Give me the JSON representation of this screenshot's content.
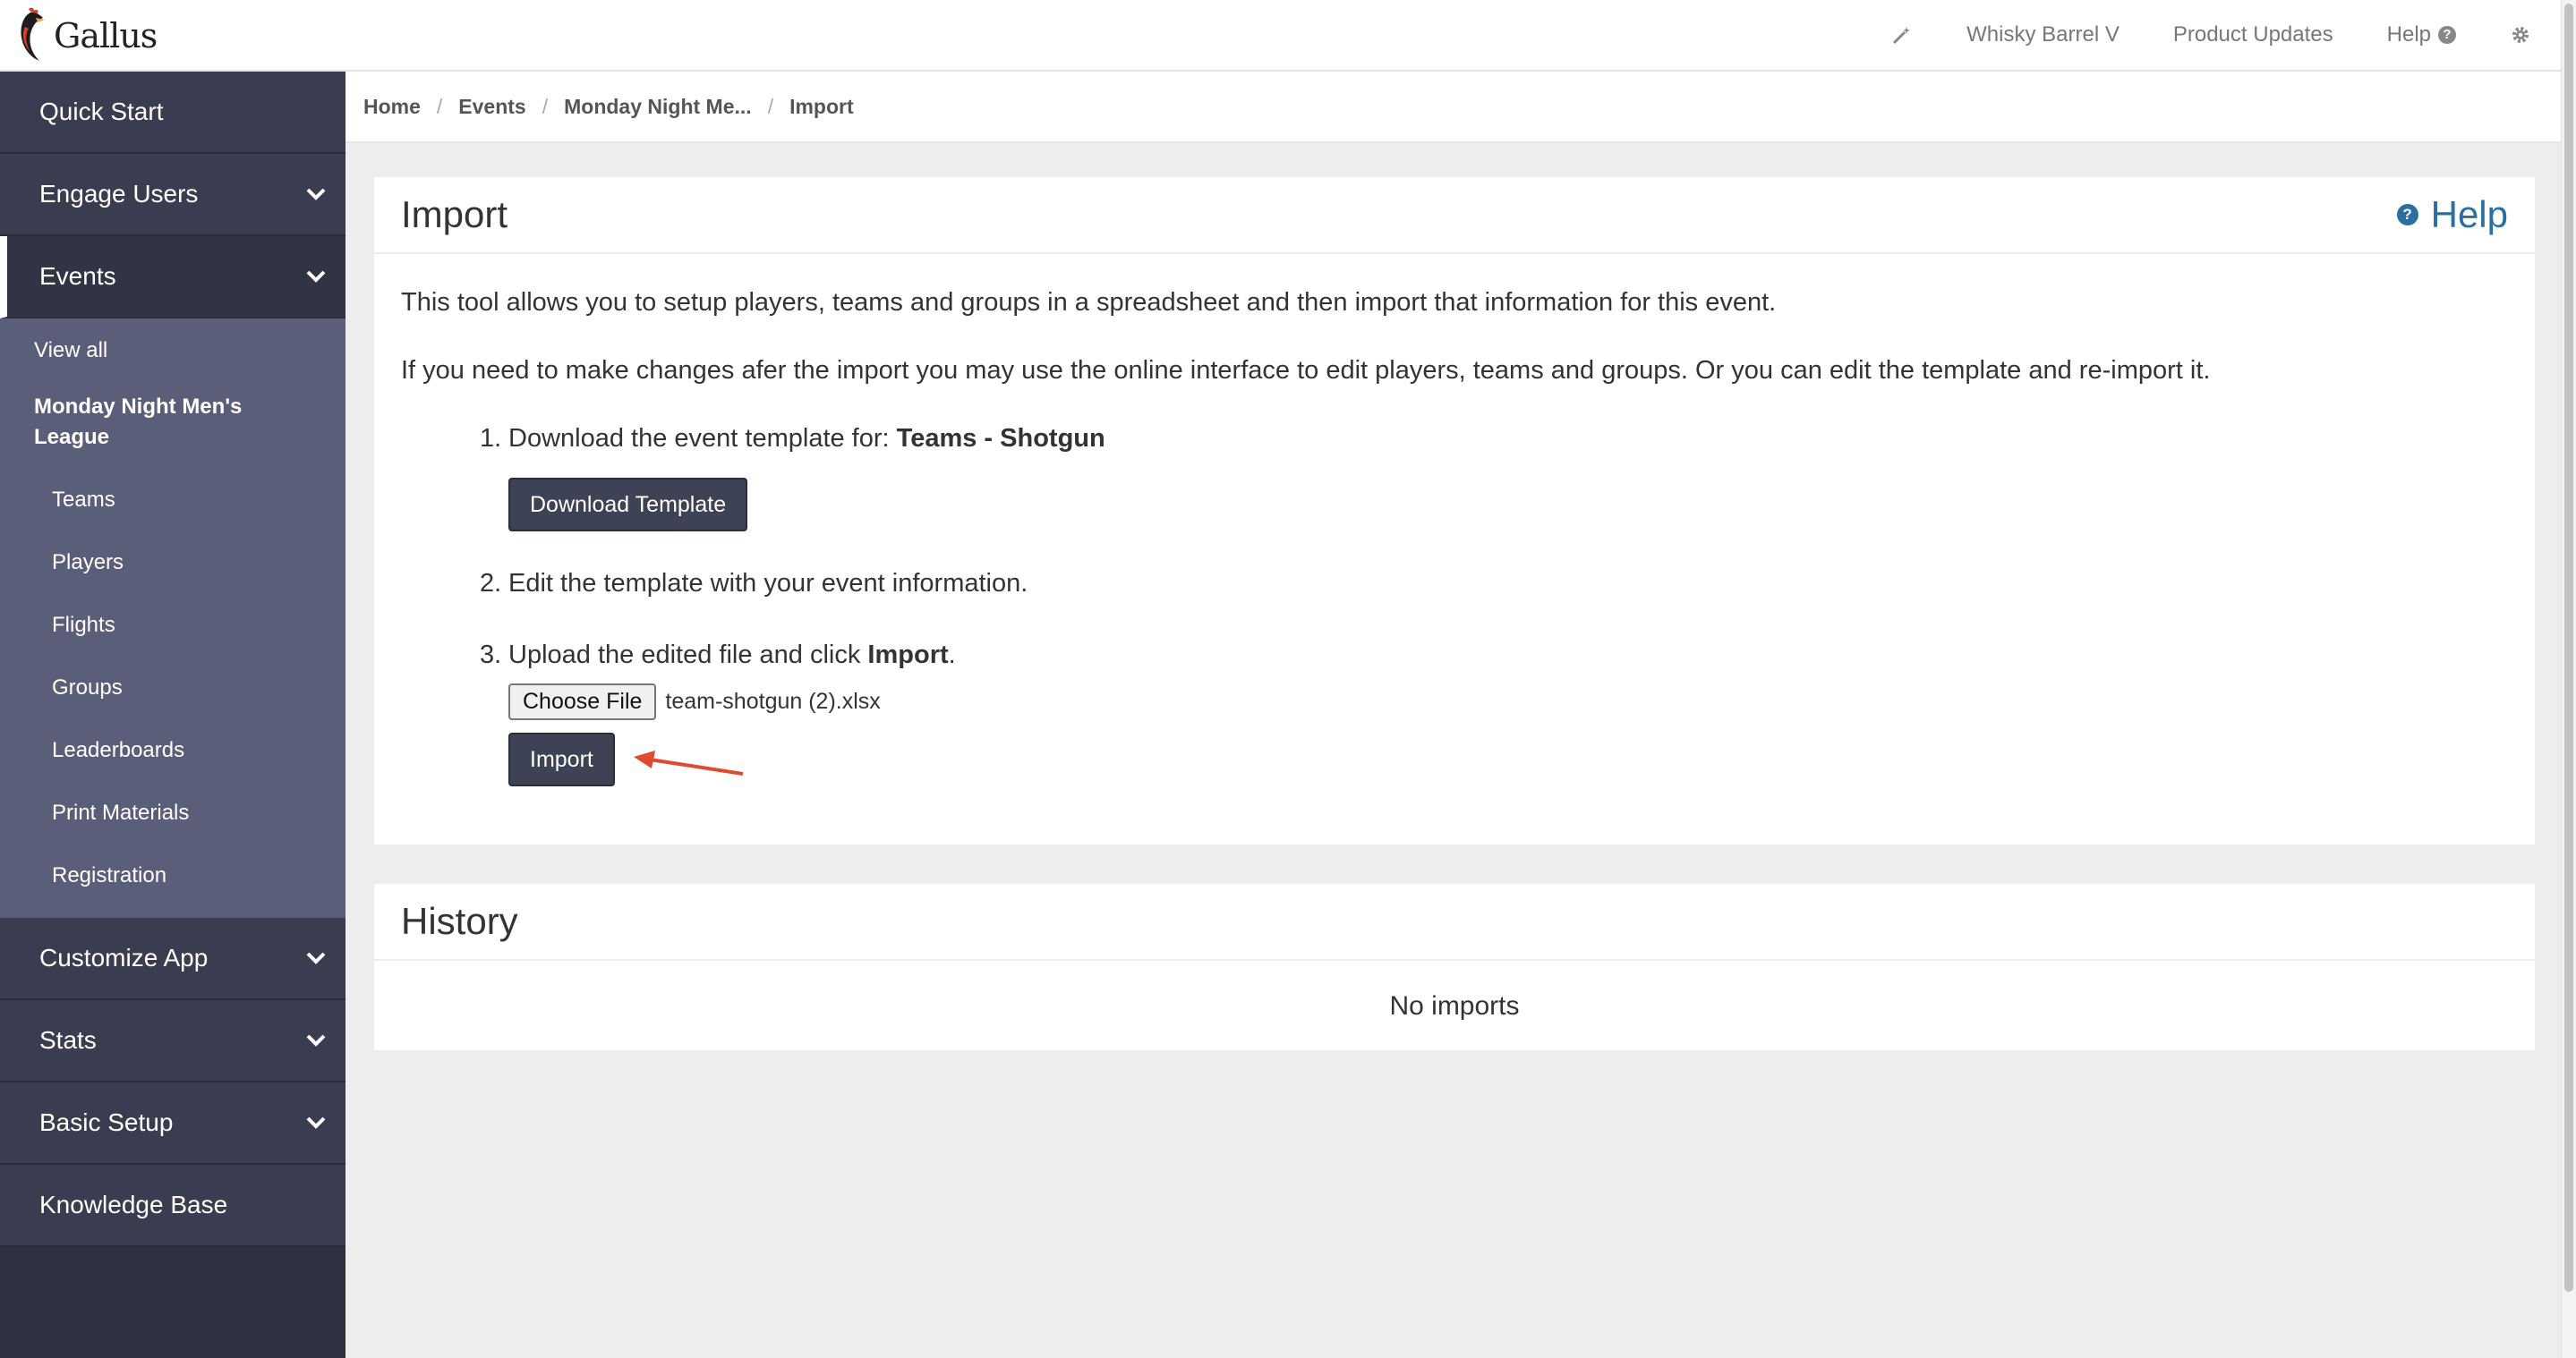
{
  "app": {
    "logo_text": "Gallus"
  },
  "topnav": {
    "wand_icon": "magic-wand-icon",
    "account": "Whisky Barrel V",
    "product_updates": "Product Updates",
    "help": "Help",
    "help_icon_glyph": "?",
    "settings_icon": "gear-icon"
  },
  "sidebar": {
    "quick_start": "Quick Start",
    "engage_users": "Engage Users",
    "events": "Events",
    "view_all": "View all",
    "event_name": "Monday Night Men's League",
    "event_items": [
      "Teams",
      "Players",
      "Flights",
      "Groups",
      "Leaderboards",
      "Print Materials",
      "Registration"
    ],
    "customize_app": "Customize App",
    "stats": "Stats",
    "basic_setup": "Basic Setup",
    "knowledge_base": "Knowledge Base"
  },
  "breadcrumb": [
    "Home",
    "Events",
    "Monday Night Me...",
    "Import"
  ],
  "import_panel": {
    "title": "Import",
    "help_label": "Help",
    "help_icon_glyph": "?",
    "intro": "This tool allows you to setup players, teams and groups in a spreadsheet and then import that information for this event.",
    "intro2": "If you need to make changes afer the import you may use the online interface to edit players, teams and groups. Or you can edit the template and re-import it.",
    "step1_num": "1.",
    "step1_text": "Download the event template for: ",
    "step1_bold": "Teams - Shotgun",
    "download_button": "Download Template",
    "step2_num": "2.",
    "step2_text": "Edit the template with your event information.",
    "step3_num": "3.",
    "step3_text": "Upload the edited file and click ",
    "step3_bold": "Import",
    "step3_end": ".",
    "choose_file": "Choose File",
    "file_name": "team-shotgun (2).xlsx",
    "import_button": "Import"
  },
  "history_panel": {
    "title": "History",
    "empty": "No imports"
  },
  "colors": {
    "sidebar_bg": "#2f3140",
    "submenu_bg": "#5b5e79",
    "button_dark": "#3d4354",
    "link_blue": "#2a6fa0",
    "annotation_arrow": "#e04a2f"
  }
}
